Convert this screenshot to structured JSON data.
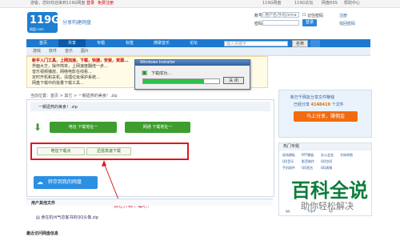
{
  "topbar": {
    "greeting": "游客，您好欢迎来到119G网盘",
    "login": "登录",
    "register": "免费注册",
    "links": [
      "119G网盘",
      "119G论坛",
      "网盘RSS",
      "帮助中心"
    ]
  },
  "header": {
    "logo_num": "119G",
    "logo_sub": "网盘.com",
    "slogan": "分享构建网盘",
    "account_label": "账号",
    "account_placeholder": "用户名/手机/email",
    "password_label": "密码",
    "remember": "记住密码",
    "login_btn": "登录",
    "register_link": "注册",
    "forgot_link": "找回密码"
  },
  "nav": {
    "items": [
      "首页",
      "共享",
      "专题",
      "标签",
      "搜歌音乐",
      "论坛"
    ],
    "search_placeholder": "输入关键字",
    "search_scope": "名称",
    "subnav": [
      "游戏",
      "软件",
      "音乐",
      "图片"
    ]
  },
  "notice": {
    "title": "新手入门工具，上网加速，下载，快捷，安装，资源...",
    "lines": [
      "界面大方，操作简单，上网速度翻倍一步...",
      "音乐视频播放，网络电影在线看...",
      "定时开机和关机，清理垃圾保护系统...",
      "网盘下载中的批量下载工具..."
    ]
  },
  "popup": {
    "title": "Windows Installer",
    "message": "下载成功...",
    "ok": "关 闭",
    "progress": 0.8
  },
  "breadcrumb": "当前位置：首页 > 其它 > 一朝遗燕的美食！.zip",
  "file": {
    "title": "一朝遗燕的美食！.zip",
    "btn_telecom": "电信 下载地址一",
    "btn_unicom": "网通 下载地址一",
    "btn_telecom_point": "电信下载点",
    "btn_fast": "迅雷高速下载",
    "save": "转存到我的网盘",
    "annotation": "现在开始下载吧！",
    "other_files_title": "用户其他文件",
    "other_file": "食在杭州气息客书的QQ头像.zip",
    "bottom_title": "最近访问网盘信息"
  },
  "sidebar": {
    "t1": "新万千网友分享文件赚钱",
    "t2a": "已经分享",
    "count": "4148419",
    "t2b": "个文件",
    "share_btn": "马上分享，赚佣金",
    "hot_title": "热门专题",
    "tags": [
      "现场模板",
      "PPT模板",
      "办公会会",
      "字体转换",
      "QQ音乐",
      "影音制作",
      "QQ空间",
      "手机软件",
      "QQ签名",
      "QQ表情",
      "qq",
      "mp4",
      "xp"
    ]
  },
  "watermark": {
    "line1": "百科全说",
    "line2": "助你轻松解决"
  }
}
